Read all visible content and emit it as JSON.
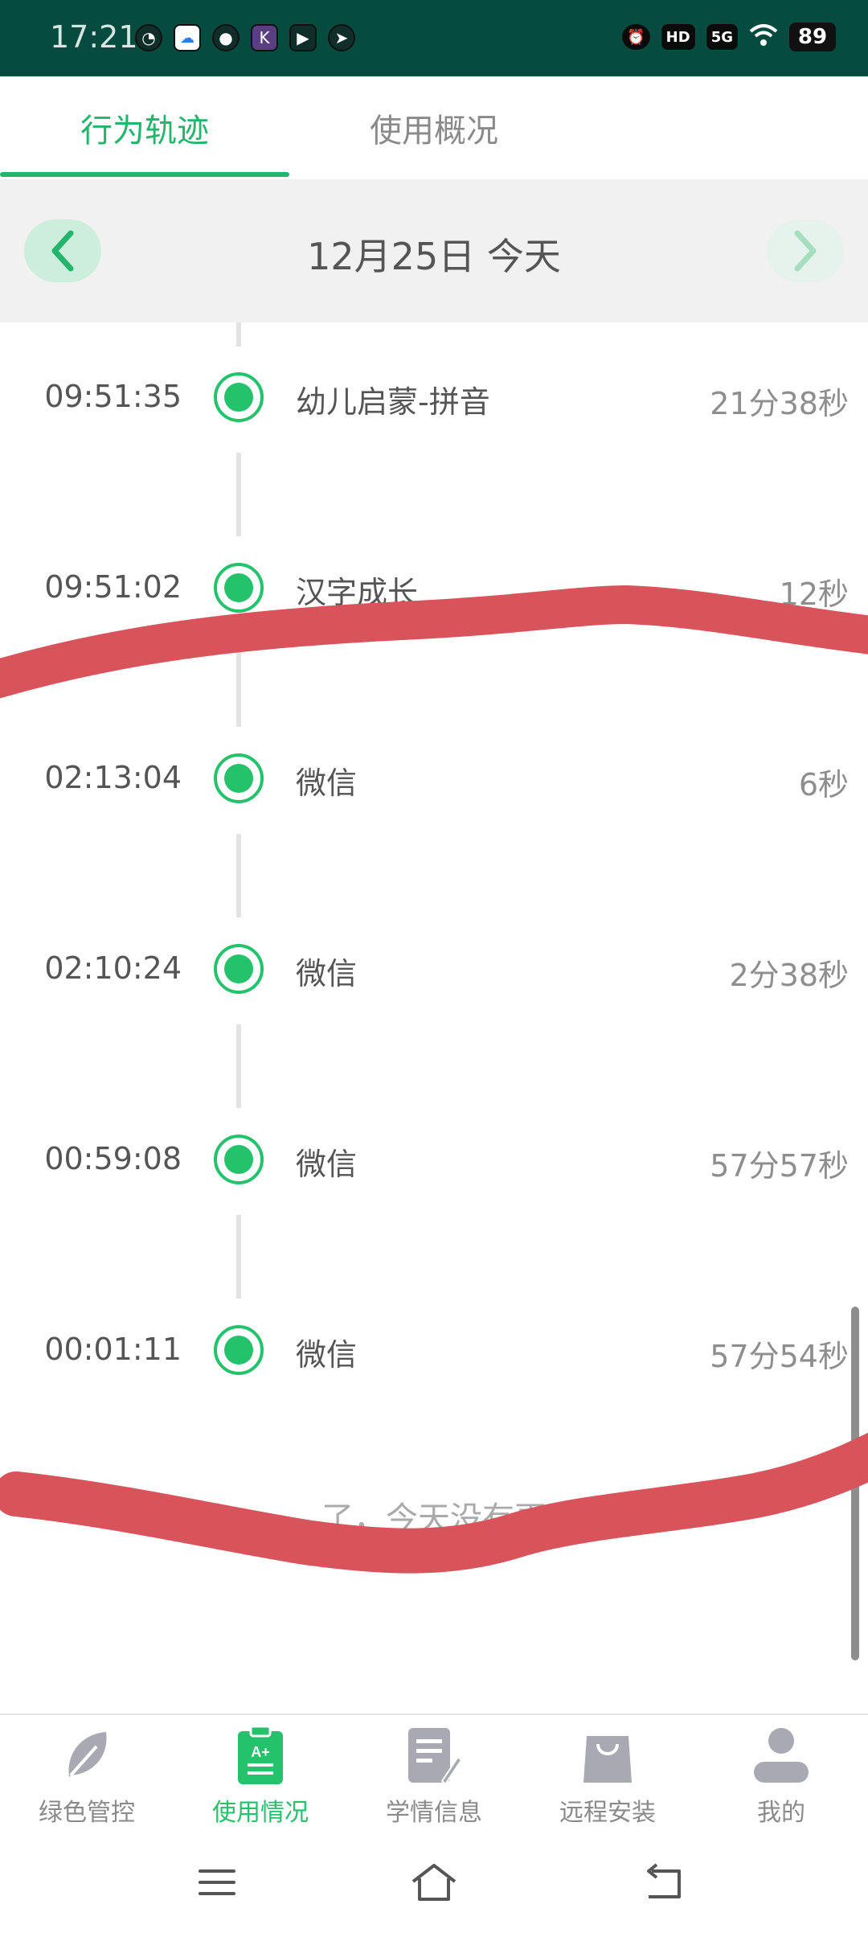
{
  "status_bar": {
    "time": "17:21",
    "battery": "89",
    "network": "5G",
    "hd_label": "HD"
  },
  "tabs": [
    {
      "label": "行为轨迹",
      "active": true
    },
    {
      "label": "使用概况",
      "active": false
    }
  ],
  "date_nav": {
    "date": "12月25日 今天"
  },
  "timeline": [
    {
      "time": "09:51:35",
      "app": "幼儿启蒙-拼音",
      "duration": "21分38秒"
    },
    {
      "time": "09:51:02",
      "app": "汉字成长",
      "duration": "12秒"
    },
    {
      "time": "02:13:04",
      "app": "微信",
      "duration": "6秒"
    },
    {
      "time": "02:10:24",
      "app": "微信",
      "duration": "2分38秒"
    },
    {
      "time": "00:59:08",
      "app": "微信",
      "duration": "57分57秒"
    },
    {
      "time": "00:01:11",
      "app": "微信",
      "duration": "57分54秒"
    }
  ],
  "end_text": "了，今天没有更",
  "bottom_nav": [
    {
      "label": "绿色管控",
      "icon": "leaf-icon",
      "active": false
    },
    {
      "label": "使用情况",
      "icon": "clipboard-grade-icon",
      "active": true
    },
    {
      "label": "学情信息",
      "icon": "document-pen-icon",
      "active": false
    },
    {
      "label": "远程安装",
      "icon": "shopping-bag-icon",
      "active": false
    },
    {
      "label": "我的",
      "icon": "person-icon",
      "active": false
    }
  ],
  "colors": {
    "status_bar_bg": "#064b3f",
    "accent_green": "#23b56b",
    "scribble_red": "#d9535a"
  }
}
